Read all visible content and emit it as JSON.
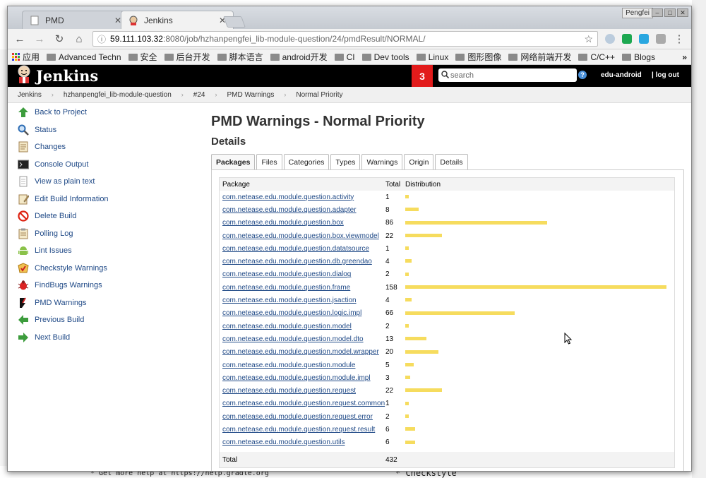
{
  "browser": {
    "tabs": [
      {
        "label": "PMD",
        "active": false
      },
      {
        "label": "Jenkins",
        "active": true
      }
    ],
    "profile_name": "Pengfei",
    "url_host": "59.111.103.32",
    "url_path": ":8080/job/hzhanpengfei_lib-module-question/24/pmdResult/NORMAL/",
    "bookmarks": [
      "应用",
      "Advanced Techn",
      "安全",
      "后台开发",
      "脚本语言",
      "android开发",
      "CI",
      "Dev tools",
      "Linux",
      "图形图像",
      "网络前端开发",
      "C/C++",
      "Blogs"
    ],
    "more_bookmarks": "»"
  },
  "jenkins": {
    "logo_text": "Jenkins",
    "notification_count": "3",
    "search_placeholder": "search",
    "user": "edu-android",
    "logout": "| log out"
  },
  "breadcrumb": [
    "Jenkins",
    "hzhanpengfei_lib-module-question",
    "#24",
    "PMD Warnings",
    "Normal Priority"
  ],
  "sidepanel": [
    {
      "label": "Back to Project",
      "icon": "up-arrow-icon"
    },
    {
      "label": "Status",
      "icon": "magnifier-icon"
    },
    {
      "label": "Changes",
      "icon": "notepad-icon"
    },
    {
      "label": "Console Output",
      "icon": "terminal-icon"
    },
    {
      "label": "View as plain text",
      "icon": "document-icon"
    },
    {
      "label": "Edit Build Information",
      "icon": "notepad-pencil-icon"
    },
    {
      "label": "Delete Build",
      "icon": "no-entry-icon"
    },
    {
      "label": "Polling Log",
      "icon": "clipboard-icon"
    },
    {
      "label": "Lint Issues",
      "icon": "android-icon"
    },
    {
      "label": "Checkstyle Warnings",
      "icon": "checkstyle-icon"
    },
    {
      "label": "FindBugs Warnings",
      "icon": "bug-icon"
    },
    {
      "label": "PMD Warnings",
      "icon": "pmd-icon"
    },
    {
      "label": "Previous Build",
      "icon": "left-arrow-icon"
    },
    {
      "label": "Next Build",
      "icon": "right-arrow-icon"
    }
  ],
  "main": {
    "title": "PMD Warnings - Normal Priority",
    "subtitle": "Details",
    "tabs": [
      "Packages",
      "Files",
      "Categories",
      "Types",
      "Warnings",
      "Origin",
      "Details"
    ],
    "selected_tab": "Packages",
    "table": {
      "headers": [
        "Package",
        "Total",
        "Distribution"
      ],
      "rows": [
        {
          "package": "com.netease.edu.module.question.activity",
          "total": "1"
        },
        {
          "package": "com.netease.edu.module.question.adapter",
          "total": "8"
        },
        {
          "package": "com.netease.edu.module.question.box",
          "total": "86"
        },
        {
          "package": "com.netease.edu.module.question.box.viewmodel",
          "total": "22"
        },
        {
          "package": "com.netease.edu.module.question.datatsource",
          "total": "1"
        },
        {
          "package": "com.netease.edu.module.question.db.greendao",
          "total": "4"
        },
        {
          "package": "com.netease.edu.module.question.dialog",
          "total": "2"
        },
        {
          "package": "com.netease.edu.module.question.frame",
          "total": "158"
        },
        {
          "package": "com.netease.edu.module.question.jsaction",
          "total": "4"
        },
        {
          "package": "com.netease.edu.module.question.logic.impl",
          "total": "66"
        },
        {
          "package": "com.netease.edu.module.question.model",
          "total": "2"
        },
        {
          "package": "com.netease.edu.module.question.model.dto",
          "total": "13"
        },
        {
          "package": "com.netease.edu.module.question.model.wrapper",
          "total": "20"
        },
        {
          "package": "com.netease.edu.module.question.module",
          "total": "5"
        },
        {
          "package": "com.netease.edu.module.question.module.impl",
          "total": "3"
        },
        {
          "package": "com.netease.edu.module.question.request",
          "total": "22"
        },
        {
          "package": "com.netease.edu.module.question.request.common",
          "total": "1"
        },
        {
          "package": "com.netease.edu.module.question.request.error",
          "total": "2"
        },
        {
          "package": "com.netease.edu.module.question.request.result",
          "total": "6"
        },
        {
          "package": "com.netease.edu.module.question.utils",
          "total": "6"
        }
      ],
      "footer_label": "Total",
      "footer_total": "432",
      "bar_color": "#f6dc5e",
      "max_total": 158
    }
  },
  "background": {
    "terminal_line": "* Get more help at https://help.gradle.org",
    "right_text": "* Checkstyle"
  }
}
